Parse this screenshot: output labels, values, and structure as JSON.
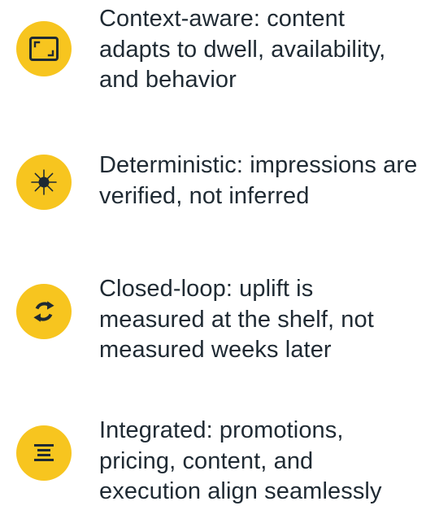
{
  "colors": {
    "badge": "#f7c51f",
    "icon": "#1f2a33",
    "text": "#1f2a33",
    "background": "#ffffff"
  },
  "features": [
    {
      "icon": "frame-corners-icon",
      "text": "Context-aware: content adapts to dwell, availability, and behavior"
    },
    {
      "icon": "starburst-icon",
      "text": "Deterministic: impressions are verified, not inferred"
    },
    {
      "icon": "refresh-loop-icon",
      "text": "Closed-loop: uplift is measured at the shelf, not measured weeks later"
    },
    {
      "icon": "align-center-icon",
      "text": "Integrated: promotions, pricing, content, and execution align seamlessly"
    }
  ]
}
